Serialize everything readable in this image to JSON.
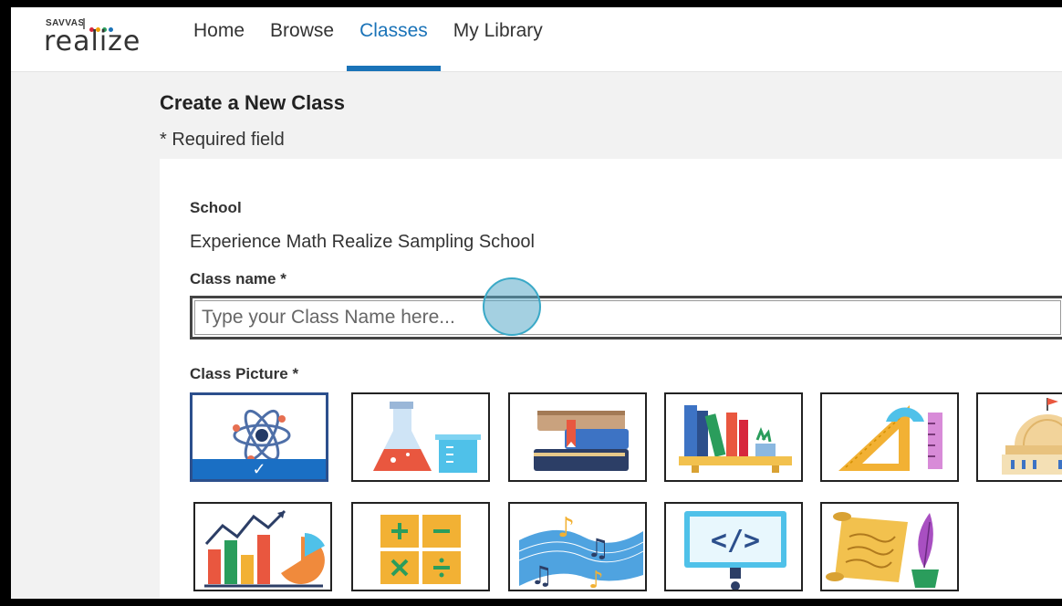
{
  "logo": {
    "brand_small": "SAVVAS",
    "brand_main": "realize",
    "dot_colors": [
      "#d7263d",
      "#f4a100",
      "#2a9d5c",
      "#1a73b8"
    ]
  },
  "nav": {
    "items": [
      {
        "label": "Home",
        "active": false
      },
      {
        "label": "Browse",
        "active": false
      },
      {
        "label": "Classes",
        "active": true
      },
      {
        "label": "My Library",
        "active": false
      }
    ]
  },
  "page": {
    "title": "Create a New Class",
    "required_note": "* Required field"
  },
  "form": {
    "school_label": "School",
    "school_value": "Experience Math Realize Sampling School",
    "class_name_label": "Class name *",
    "class_name_placeholder": "Type your Class Name here...",
    "class_name_value": "",
    "class_picture_label": "Class Picture *",
    "pictures": [
      {
        "icon": "atom-science-icon",
        "selected": true
      },
      {
        "icon": "chemistry-flask-icon",
        "selected": false
      },
      {
        "icon": "books-stack-icon",
        "selected": false
      },
      {
        "icon": "bookshelf-plant-icon",
        "selected": false
      },
      {
        "icon": "geometry-tools-icon",
        "selected": false
      },
      {
        "icon": "capitol-building-icon",
        "selected": false
      },
      {
        "icon": "charts-graphs-icon",
        "selected": false
      },
      {
        "icon": "math-operators-icon",
        "selected": false
      },
      {
        "icon": "music-notes-icon",
        "selected": false
      },
      {
        "icon": "coding-monitor-icon",
        "selected": false
      },
      {
        "icon": "scroll-quill-icon",
        "selected": false
      }
    ]
  },
  "colors": {
    "accent": "#1a73b8",
    "selected_border": "#2c4f8c"
  }
}
